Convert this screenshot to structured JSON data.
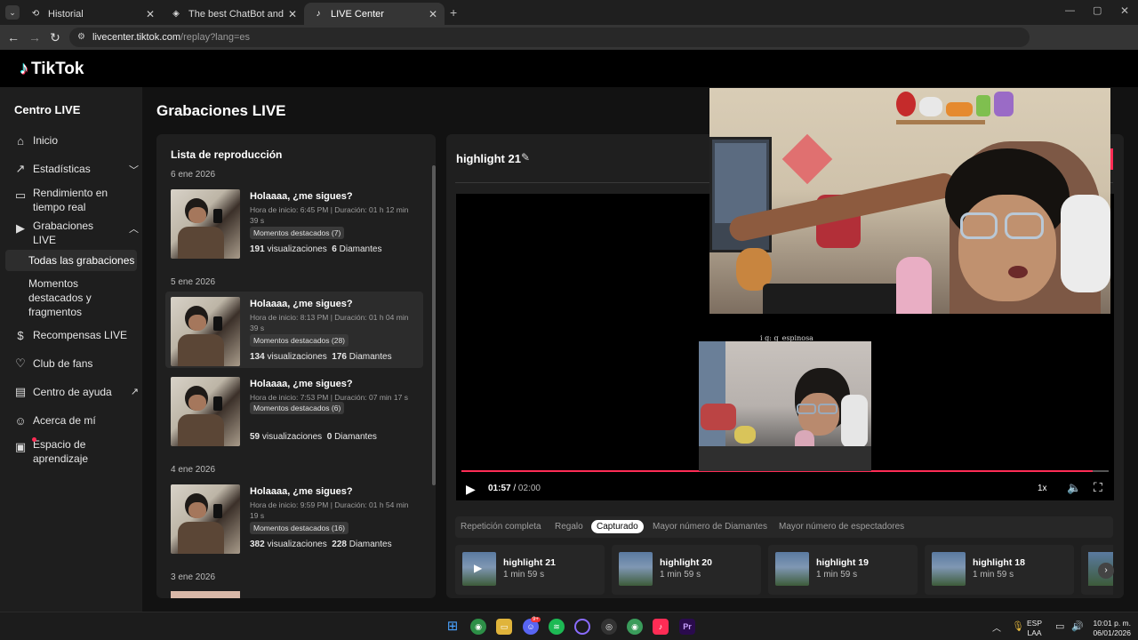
{
  "browser": {
    "tabs": [
      {
        "title": "Historial"
      },
      {
        "title": "The best ChatBot and Widgets"
      },
      {
        "title": "LIVE Center"
      }
    ],
    "url_host": "livecenter.tiktok.com",
    "url_path": "/replay?lang=es"
  },
  "brand": {
    "name": "TikTok"
  },
  "sidebar": {
    "title": "Centro LIVE",
    "items": [
      {
        "label": "Inicio",
        "icon": "home-icon"
      },
      {
        "label": "Estadísticas",
        "icon": "chart-icon"
      },
      {
        "label": "Rendimiento en tiempo real",
        "icon": "monitor-icon"
      },
      {
        "label": "Grabaciones LIVE",
        "icon": "recordings-icon"
      },
      {
        "label": "Recompensas LIVE",
        "icon": "dollar-icon"
      },
      {
        "label": "Club de fans",
        "icon": "heart-icon"
      },
      {
        "label": "Centro de ayuda",
        "icon": "book-icon"
      },
      {
        "label": "Acerca de mí",
        "icon": "person-icon"
      },
      {
        "label": "Espacio de aprendizaje",
        "icon": "learning-icon"
      }
    ],
    "subitems": [
      {
        "label": "Todas las grabaciones"
      },
      {
        "label": "Momentos destacados y fragmentos"
      }
    ]
  },
  "main": {
    "title": "Grabaciones LIVE"
  },
  "playlist": {
    "heading": "Lista de reproducción",
    "groups": [
      {
        "date": "6 ene 2026"
      },
      {
        "date": "5 ene 2026"
      },
      {
        "date": "4 ene 2026"
      },
      {
        "date": "3 ene 2026"
      }
    ],
    "records": [
      {
        "title": "Holaaaa, ¿me sigues?",
        "meta": "Hora de inicio: 6:45 PM | Duración: 01 h 12 min 39 s",
        "badge": "Momentos destacados (7)",
        "views": "191",
        "views_label": "visualizaciones",
        "diamonds": "6",
        "diamonds_label": "Diamantes"
      },
      {
        "title": "Holaaaa, ¿me sigues?",
        "meta": "Hora de inicio: 8:13 PM | Duración: 01 h 04 min 39 s",
        "badge": "Momentos destacados (28)",
        "views": "134",
        "views_label": "visualizaciones",
        "diamonds": "176",
        "diamonds_label": "Diamantes"
      },
      {
        "title": "Holaaaa, ¿me sigues?",
        "meta": "Hora de inicio: 7:53 PM | Duración: 07 min 17 s",
        "badge": "Momentos destacados (6)",
        "views": "59",
        "views_label": "visualizaciones",
        "diamonds": "0",
        "diamonds_label": "Diamantes"
      },
      {
        "title": "Holaaaa, ¿me sigues?",
        "meta": "Hora de inicio: 9:59 PM | Duración: 01 h 54 min 19 s",
        "badge": "Momentos destacados (16)",
        "views": "382",
        "views_label": "visualizaciones",
        "diamonds": "228",
        "diamonds_label": "Diamantes"
      }
    ]
  },
  "player": {
    "title": "highlight 21",
    "current_time": "01:57",
    "separator": " / ",
    "total_time": "02:00",
    "progress_fraction": 0.975,
    "speed": "1x",
    "camera_caption": "i g: g_espinosa",
    "tabs": [
      {
        "label": "Repetición completa"
      },
      {
        "label": "Regalo"
      },
      {
        "label": "Capturado"
      },
      {
        "label": "Mayor número de Diamantes"
      },
      {
        "label": "Mayor número de espectadores"
      }
    ],
    "clips": [
      {
        "name": "highlight 21",
        "duration": "1 min 59 s"
      },
      {
        "name": "highlight 20",
        "duration": "1 min 59 s"
      },
      {
        "name": "highlight 19",
        "duration": "1 min 59 s"
      },
      {
        "name": "highlight 18",
        "duration": "1 min 59 s"
      }
    ]
  },
  "taskbar": {
    "lang": "ESP",
    "lang_sub": "LAA",
    "time": "10:01 p. m.",
    "date": "06/01/2026",
    "discord_badge": "9+"
  },
  "colors": {
    "accent": "#fe2c55",
    "background": "#121212",
    "panel": "#1f1f1f"
  }
}
